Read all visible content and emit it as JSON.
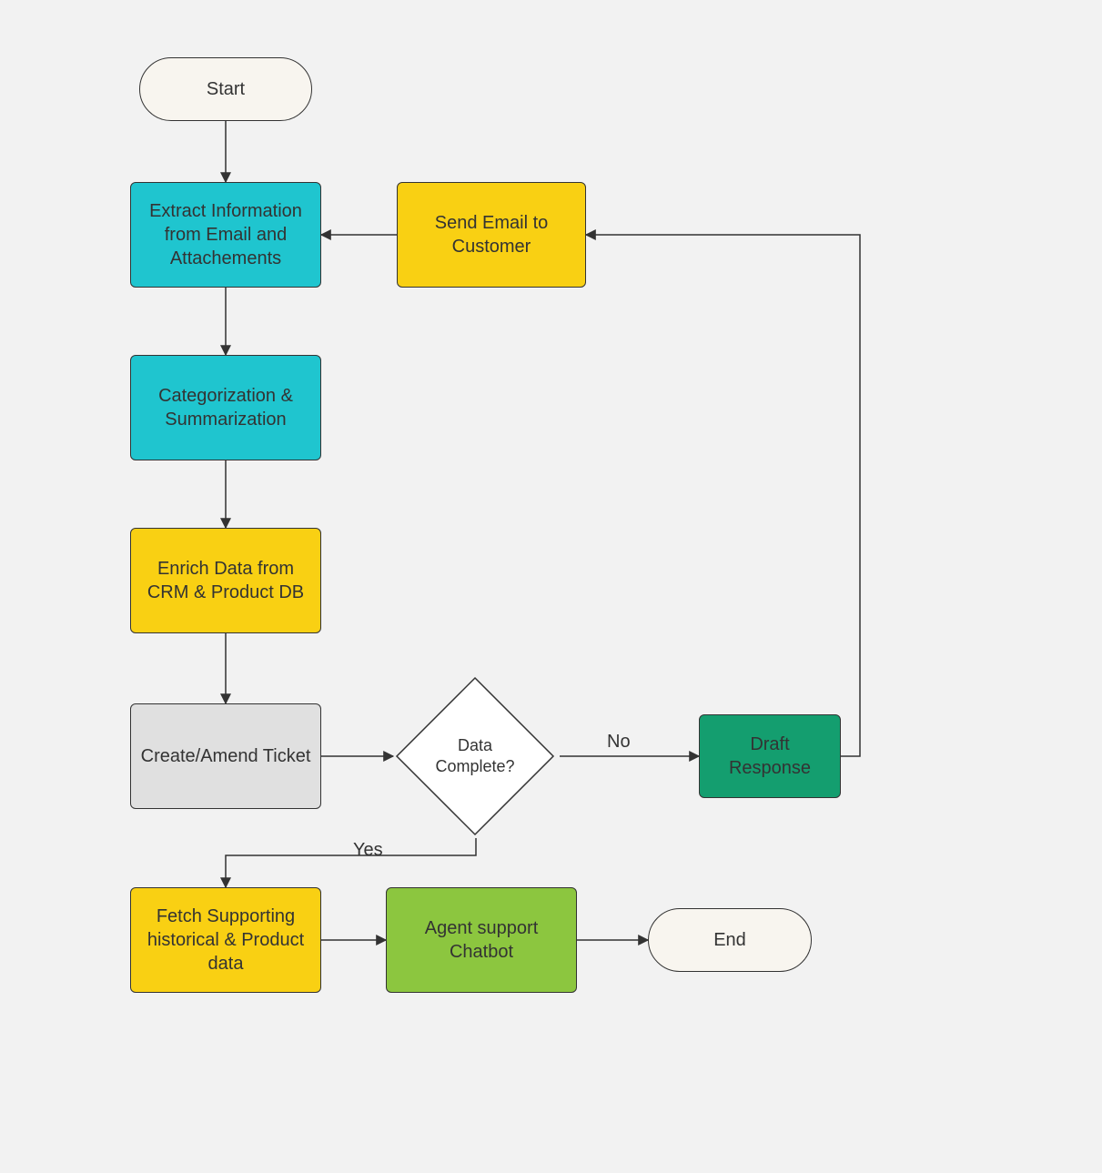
{
  "nodes": {
    "start": "Start",
    "extract": "Extract Information from Email and Attachements",
    "catsum": "Categorization & Summarization",
    "enrich": "Enrich Data from CRM & Product DB",
    "ticket": "Create/Amend Ticket",
    "decision": "Data Complete?",
    "draft": "Draft Response",
    "send": "Send Email to Customer",
    "fetch": "Fetch Supporting historical & Product data",
    "chatbot": "Agent support Chatbot",
    "end": "End"
  },
  "edge_labels": {
    "yes": "Yes",
    "no": "No"
  },
  "colors": {
    "teal": "#1fc5cf",
    "yellow": "#f9d013",
    "grey": "#e0e0e0",
    "dkgreen": "#149e6f",
    "green": "#8cc63f",
    "terminal": "#f8f5ef",
    "bg": "#f2f2f2",
    "stroke": "#333333"
  }
}
